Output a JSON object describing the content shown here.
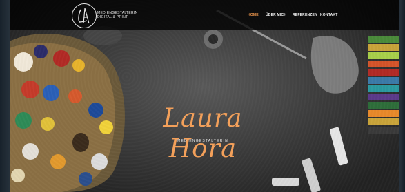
{
  "header": {
    "logo_text_line1": "MEDIENGESTALTERIN",
    "logo_text_line2": "DIGITAL & PRINT",
    "nav": [
      {
        "label": "HOME",
        "active": true
      },
      {
        "label": "ÜBER MICH",
        "active": false
      },
      {
        "label": "REFERENZEN",
        "active": false
      },
      {
        "label": "KONTAKT",
        "active": false
      }
    ]
  },
  "hero": {
    "title": "Laura Hora",
    "subtitle": "MEDIENGESTALTERIN"
  },
  "colors": {
    "accent": "#f39a4e",
    "navbar_bg": "#000000",
    "text": "#ffffff"
  }
}
